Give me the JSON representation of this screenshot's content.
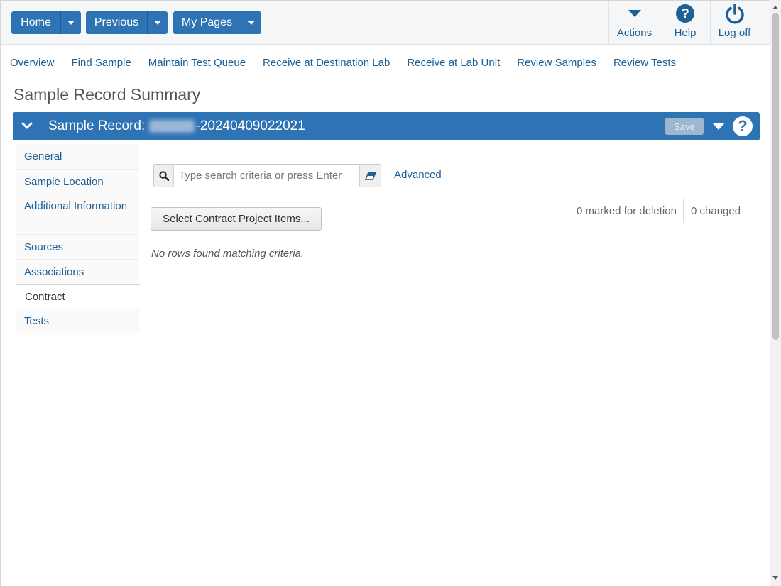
{
  "toolbar": {
    "home_label": "Home",
    "previous_label": "Previous",
    "mypages_label": "My Pages",
    "actions_label": "Actions",
    "help_label": "Help",
    "logoff_label": "Log off"
  },
  "nav": {
    "links": [
      "Overview",
      "Find Sample",
      "Maintain Test Queue",
      "Receive at Destination Lab",
      "Receive at Lab Unit",
      "Review Samples",
      "Review Tests"
    ]
  },
  "page": {
    "title": "Sample Record Summary"
  },
  "panel": {
    "title_prefix": "Sample Record:",
    "record_suffix": "-20240409022021",
    "save_label": "Save"
  },
  "sidebar": {
    "items": [
      {
        "label": "General"
      },
      {
        "label": "Sample Location"
      },
      {
        "label": "Additional Information"
      },
      {
        "label": "Sources"
      },
      {
        "label": "Associations"
      },
      {
        "label": "Contract",
        "active": true
      },
      {
        "label": "Tests"
      }
    ]
  },
  "search": {
    "placeholder": "Type search criteria or press Enter",
    "value": "",
    "advanced_label": "Advanced"
  },
  "contract": {
    "select_button_label": "Select Contract Project Items...",
    "marked_for_deletion": "0 marked for deletion",
    "changed": "0 changed",
    "empty_message": "No rows found matching criteria."
  },
  "colors": {
    "primary": "#2e74b5",
    "link": "#1e5f94"
  }
}
